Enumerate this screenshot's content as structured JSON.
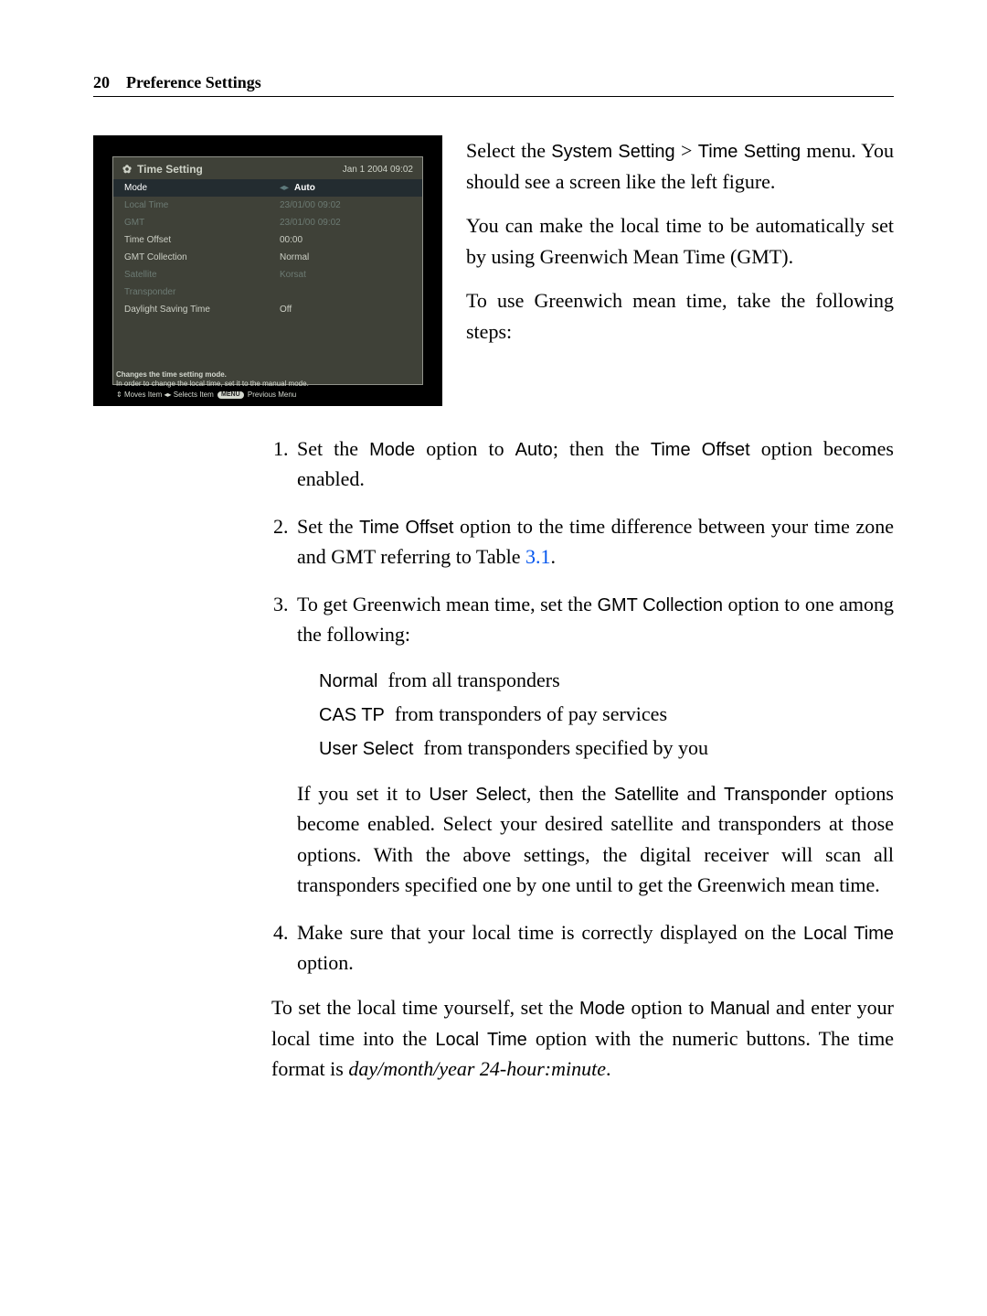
{
  "header": {
    "page_number": "20",
    "page_title": "Preference Settings"
  },
  "figure": {
    "title": "Time Setting",
    "date": "Jan 1 2004 09:02",
    "rows": [
      {
        "label": "Mode",
        "value": "Auto",
        "state": "selected"
      },
      {
        "label": "Local Time",
        "value": "23/01/00 09:02",
        "state": "disabled"
      },
      {
        "label": "GMT",
        "value": "23/01/00 09:02",
        "state": "disabled"
      },
      {
        "label": "Time Offset",
        "value": "00:00",
        "state": "normal"
      },
      {
        "label": "GMT Collection",
        "value": "Normal",
        "state": "normal"
      },
      {
        "label": "Satellite",
        "value": "Korsat",
        "state": "disabled"
      },
      {
        "label": "Transponder",
        "value": "",
        "state": "disabled"
      },
      {
        "label": "Daylight Saving Time",
        "value": "Off",
        "state": "normal"
      }
    ],
    "hint1": "Changes the time setting mode.",
    "hint2": "In order to change the local time, set it to the manual mode.",
    "hint3_prefix": "Moves Item",
    "hint3_mid": "Selects Item",
    "hint3_menu": "MENU",
    "hint3_suffix": "Previous Menu"
  },
  "para1": {
    "t1": "Select the ",
    "s1": "System Setting",
    "gt": " > ",
    "s2": "Time Setting",
    "t2": " menu. You should see a screen like the left figure."
  },
  "para2": "You can make the local time to be automatically set by using Greenwich Mean Time (GMT).",
  "para3": "To use Greenwich mean time, take the following steps:",
  "steps": {
    "s1": {
      "t1": "Set the ",
      "s1": "Mode",
      "t2": " option to ",
      "s2": "Auto",
      "t3": "; then the ",
      "s3": "Time Offset",
      "t4": " option becomes enabled."
    },
    "s2": {
      "t1": "Set the ",
      "s1": "Time Offset",
      "t2": " option to the time difference between your time zone and GMT referring to Table ",
      "link": "3.1",
      "t3": "."
    },
    "s3": {
      "t1": "To get Greenwich mean time, set the ",
      "s1": "GMT Collection",
      "t2": " option to one among the following:",
      "defs": {
        "d1_term": "Normal",
        "d1_desc": "from all transponders",
        "d2_term": "CAS TP",
        "d2_desc": "from transponders of pay services",
        "d3_term": "User Select",
        "d3_desc": "from transponders specified by you"
      },
      "after": {
        "t1": "If you set it to ",
        "s1": "User Select",
        "t2": ", then the ",
        "s2": "Satellite",
        "t3": " and ",
        "s3": "Transponder",
        "t4": " options become enabled. Select your desired satellite and transponders at those options. With the above settings, the digital receiver will scan all transponders specified one by one until to get the Greenwich mean time."
      }
    },
    "s4": {
      "t1": "Make sure that your local time is correctly displayed on the ",
      "s1": "Local Time",
      "t2": " option."
    }
  },
  "para4": {
    "t1": "To set the local time yourself, set the ",
    "s1": "Mode",
    "t2": " option to ",
    "s2": "Manual",
    "t3": " and enter your local time into the ",
    "s3": "Local Time",
    "t4": " option with the numeric buttons. The time format is ",
    "i1": "day/month/year 24-hour:minute",
    "t5": "."
  }
}
